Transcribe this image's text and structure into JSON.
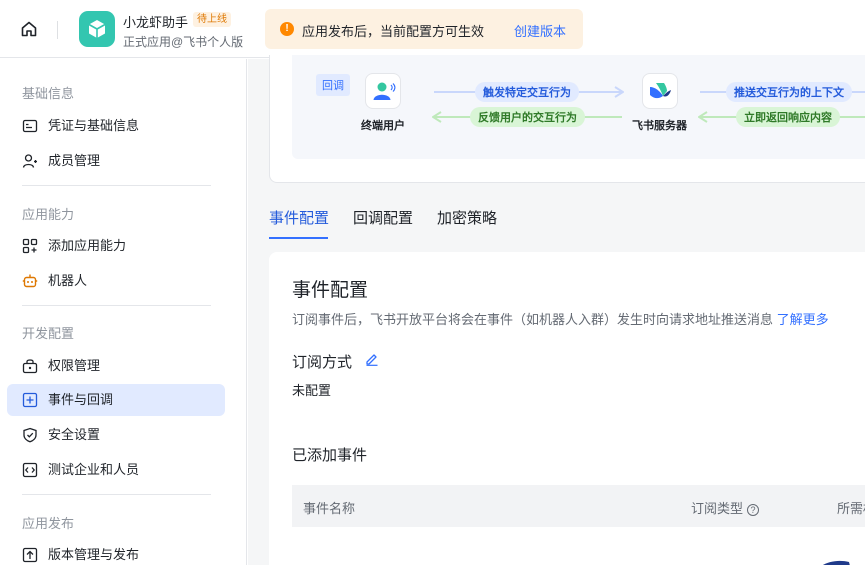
{
  "header": {
    "app_name": "小龙虾助手",
    "app_badge": "待上线",
    "app_subtitle": "正式应用@飞书个人版",
    "notice_text": "应用发布后，当前配置方可生效",
    "notice_link": "创建版本",
    "notice_icon": "!"
  },
  "sidebar": {
    "sections": [
      {
        "title": "基础信息",
        "items": [
          {
            "label": "凭证与基础信息",
            "icon": "credential-icon"
          },
          {
            "label": "成员管理",
            "icon": "member-icon"
          }
        ]
      },
      {
        "title": "应用能力",
        "items": [
          {
            "label": "添加应用能力",
            "icon": "add-capability-icon"
          },
          {
            "label": "机器人",
            "icon": "robot-icon"
          }
        ]
      },
      {
        "title": "开发配置",
        "items": [
          {
            "label": "权限管理",
            "icon": "permission-icon"
          },
          {
            "label": "事件与回调",
            "icon": "event-icon",
            "active": true
          },
          {
            "label": "安全设置",
            "icon": "shield-icon"
          },
          {
            "label": "测试企业和人员",
            "icon": "test-icon"
          }
        ]
      },
      {
        "title": "应用发布",
        "items": [
          {
            "label": "版本管理与发布",
            "icon": "publish-icon"
          }
        ]
      }
    ]
  },
  "flow": {
    "tag": "回调",
    "end_user": "终端用户",
    "server": "飞书服务器",
    "trigger": "触发特定交互行为",
    "feedback": "反馈用户的交互行为",
    "push_context": "推送交互行为的上下文",
    "return_content": "立即返回响应内容"
  },
  "tabs": [
    "事件配置",
    "回调配置",
    "加密策略"
  ],
  "config": {
    "title": "事件配置",
    "description": "订阅事件后，飞书开放平台将会在事件（如机器人入群）发生时向请求地址推送消息",
    "learn_more": "了解更多",
    "sub_label": "订阅方式",
    "sub_value": "未配置",
    "added_title": "已添加事件",
    "columns": [
      "事件名称",
      "订阅类型",
      "所需权"
    ],
    "help_glyph": "?"
  },
  "colors": {
    "accent": "#3370ff",
    "active_bg": "#e1eaff",
    "logo": "#33c6b0",
    "notice_bg": "#fdf1e1"
  }
}
